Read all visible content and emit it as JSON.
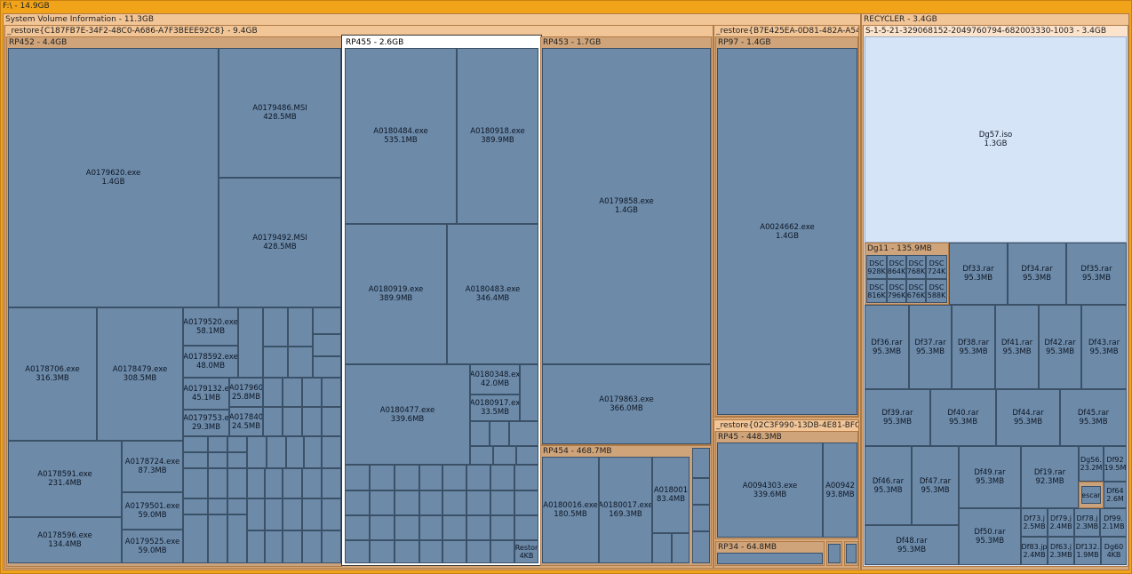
{
  "root": {
    "label": "F:\\ - 14.9GB"
  },
  "svi": {
    "label": "System Volume Information - 11.3GB"
  },
  "restore_c": {
    "label": "_restore{C187FB7E-34F2-48C0-A686-A7F3BEEE92C8} - 9.4GB"
  },
  "rp452": {
    "label": "RP452 - 4.4GB",
    "files": [
      {
        "name": "A0179620.exe",
        "size": "1.4GB"
      },
      {
        "name": "A0179486.MSI",
        "size": "428.5MB"
      },
      {
        "name": "A0179492.MSI",
        "size": "428.5MB"
      },
      {
        "name": "A0178706.exe",
        "size": "316.3MB"
      },
      {
        "name": "A0178479.exe",
        "size": "308.5MB"
      },
      {
        "name": "A0178591.exe",
        "size": "231.4MB"
      },
      {
        "name": "A0178724.exe",
        "size": "87.3MB"
      },
      {
        "name": "A0179501.exe",
        "size": "59.0MB"
      },
      {
        "name": "A0178596.exe",
        "size": "134.4MB"
      },
      {
        "name": "A0179525.exe",
        "size": "59.0MB"
      },
      {
        "name": "A0179520.exe",
        "size": "58.1MB"
      },
      {
        "name": "A0178592.exe",
        "size": "48.0MB"
      },
      {
        "name": "A0179132.e",
        "size": "45.1MB"
      },
      {
        "name": "A0179753.e",
        "size": "29.3MB"
      },
      {
        "name": "A017960",
        "size": "25.8MB"
      },
      {
        "name": "A017840",
        "size": "24.5MB"
      }
    ]
  },
  "rp455": {
    "label": "RP455 - 2.6GB",
    "files": [
      {
        "name": "A0180484.exe",
        "size": "535.1MB"
      },
      {
        "name": "A0180918.exe",
        "size": "389.9MB"
      },
      {
        "name": "A0180919.exe",
        "size": "389.9MB"
      },
      {
        "name": "A0180483.exe",
        "size": "346.4MB"
      },
      {
        "name": "A0180477.exe",
        "size": "339.6MB"
      },
      {
        "name": "A0180348.ex",
        "size": "42.0MB"
      },
      {
        "name": "A0180917.ex",
        "size": "33.5MB"
      },
      {
        "name": "Restor",
        "size": "4KB"
      }
    ]
  },
  "rp453": {
    "label": "RP453 - 1.7GB",
    "files": [
      {
        "name": "A0179858.exe",
        "size": "1.4GB"
      },
      {
        "name": "A0179863.exe",
        "size": "366.0MB"
      }
    ]
  },
  "rp454": {
    "label": "RP454 - 468.7MB",
    "files": [
      {
        "name": "A0180016.exe",
        "size": "180.5MB"
      },
      {
        "name": "A0180017.exe",
        "size": "169.3MB"
      },
      {
        "name": "A018001",
        "size": "83.4MB"
      }
    ]
  },
  "restore_b": {
    "label": "_restore{B7E425EA-0D81-482A-A544-C"
  },
  "rp97": {
    "label": "RP97 - 1.4GB",
    "files": [
      {
        "name": "A0024662.exe",
        "size": "1.4GB"
      }
    ]
  },
  "restore_02": {
    "label": "_restore{02C3F990-13DB-4E81-BFC4-C"
  },
  "rp45": {
    "label": "RP45 - 448.3MB",
    "files": [
      {
        "name": "A0094303.exe",
        "size": "339.6MB"
      },
      {
        "name": "A00942",
        "size": "93.8MB"
      }
    ]
  },
  "rp34": {
    "label": "RP34 - 64.8MB"
  },
  "recycler": {
    "label": "RECYCLER - 3.4GB"
  },
  "sid": {
    "label": "S-1-5-21-329068152-2049760794-682003330-1003 - 3.4GB"
  },
  "iso": {
    "name": "Dg57.iso",
    "size": "1.3GB"
  },
  "dg11": {
    "label": "Dg11 - 135.9MB",
    "files": [
      {
        "name": "DSC",
        "size": "928K"
      },
      {
        "name": "DSC",
        "size": "864K"
      },
      {
        "name": "DSC",
        "size": "768K"
      },
      {
        "name": "DSC",
        "size": "724K"
      },
      {
        "name": "DSC",
        "size": "816K"
      },
      {
        "name": "DSC",
        "size": "796K"
      },
      {
        "name": "DSC",
        "size": "676K"
      },
      {
        "name": "DSC",
        "size": "588K"
      }
    ]
  },
  "rars": [
    {
      "name": "Df33.rar",
      "size": "95.3MB"
    },
    {
      "name": "Df34.rar",
      "size": "95.3MB"
    },
    {
      "name": "Df35.rar",
      "size": "95.3MB"
    },
    {
      "name": "Df36.rar",
      "size": "95.3MB"
    },
    {
      "name": "Df37.rar",
      "size": "95.3MB"
    },
    {
      "name": "Df38.rar",
      "size": "95.3MB"
    },
    {
      "name": "Df41.rar",
      "size": "95.3MB"
    },
    {
      "name": "Df42.rar",
      "size": "95.3MB"
    },
    {
      "name": "Df43.rar",
      "size": "95.3MB"
    },
    {
      "name": "Df39.rar",
      "size": "95.3MB"
    },
    {
      "name": "Df40.rar",
      "size": "95.3MB"
    },
    {
      "name": "Df44.rar",
      "size": "95.3MB"
    },
    {
      "name": "Df45.rar",
      "size": "95.3MB"
    },
    {
      "name": "Df46.rar",
      "size": "95.3MB"
    },
    {
      "name": "Df47.rar",
      "size": "95.3MB"
    },
    {
      "name": "Df49.rar",
      "size": "95.3MB"
    },
    {
      "name": "Df19.rar",
      "size": "92.3MB"
    },
    {
      "name": "Df48.rar",
      "size": "95.3MB"
    },
    {
      "name": "Df50.rar",
      "size": "95.3MB"
    },
    {
      "name": "Df73.j",
      "size": "2.5MB"
    },
    {
      "name": "Df79.j",
      "size": "2.4MB"
    },
    {
      "name": "Df78.j",
      "size": "2.3MB"
    },
    {
      "name": "Df99.",
      "size": "2.1MB"
    },
    {
      "name": "Df83.jp",
      "size": "2.4MB"
    },
    {
      "name": "Df63.j",
      "size": "2.3MB"
    },
    {
      "name": "Df132.",
      "size": "1.9MB"
    },
    {
      "name": "Dg60",
      "size": "4KB"
    },
    {
      "name": "Dg56.",
      "size": "23.2M"
    },
    {
      "name": "Df92",
      "size": "19.5M"
    },
    {
      "name": "Df64",
      "size": "2.6M"
    },
    {
      "name": "escar",
      "size": ""
    }
  ]
}
